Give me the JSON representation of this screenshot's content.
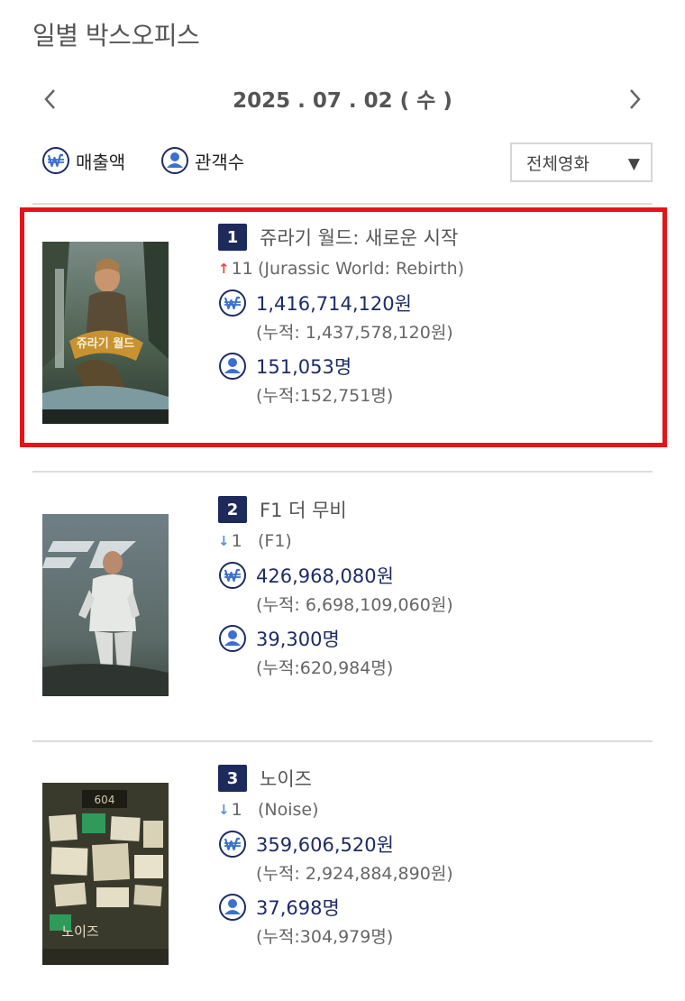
{
  "page_title": "일별 박스오피스",
  "date_nav": {
    "date": "2025 . 07 . 02 ( 수 )"
  },
  "filters": {
    "sales_label": "매출액",
    "audience_label": "관객수",
    "select_value": "전체영화"
  },
  "colors": {
    "navy": "#1d2a5b",
    "highlight": "#e8131a",
    "up": "#e8453c",
    "down": "#5b8fd6"
  },
  "movies": [
    {
      "rank": "1",
      "title": "쥬라기 월드: 새로운 시작",
      "change_dir": "up",
      "change_value": "11",
      "original_title": "(Jurassic World: Rebirth)",
      "sales": "1,416,714,120원",
      "sales_cumulative": "(누적: 1,437,578,120원)",
      "audience": "151,053명",
      "audience_cumulative": "(누적:152,751명)"
    },
    {
      "rank": "2",
      "title": "F1 더 무비",
      "change_dir": "down",
      "change_value": "1",
      "original_title": "(F1)",
      "sales": "426,968,080원",
      "sales_cumulative": "(누적: 6,698,109,060원)",
      "audience": "39,300명",
      "audience_cumulative": "(누적:620,984명)"
    },
    {
      "rank": "3",
      "title": "노이즈",
      "change_dir": "down",
      "change_value": "1",
      "original_title": "(Noise)",
      "sales": "359,606,520원",
      "sales_cumulative": "(누적: 2,924,884,890원)",
      "audience": "37,698명",
      "audience_cumulative": "(누적:304,979명)"
    }
  ],
  "posters": {
    "p1_text": "쥬라기 월드",
    "p3_room": "604",
    "p3_text": "노이즈"
  }
}
